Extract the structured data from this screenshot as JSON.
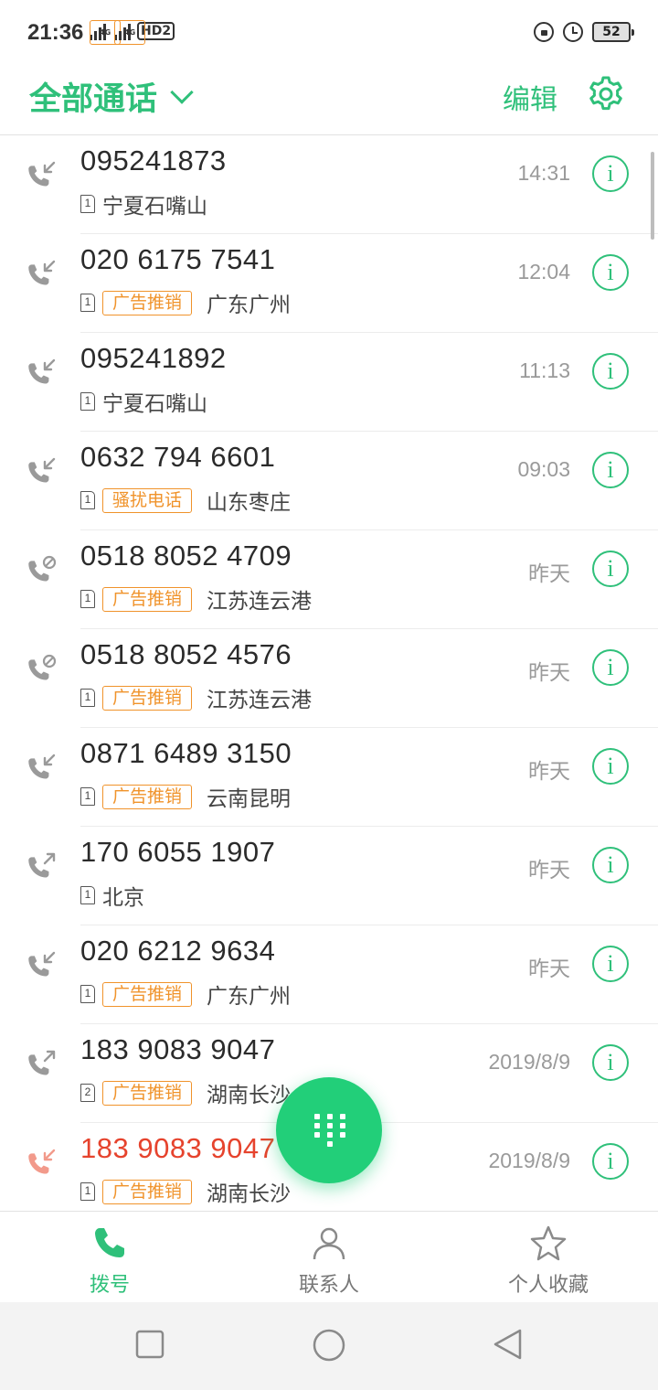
{
  "status_bar": {
    "time": "21:36",
    "net_tag": "4G",
    "hd_label": "HD2",
    "battery": "52"
  },
  "header": {
    "filter_label": "全部通话",
    "edit_label": "编辑"
  },
  "colors": {
    "accent": "#2fc07a",
    "missed": "#e6432d",
    "tag": "#f0932b"
  },
  "calls": [
    {
      "number": "095241873",
      "sim": "1",
      "tag": "",
      "location": "宁夏石嘴山",
      "time": "14:31",
      "type": "incoming"
    },
    {
      "number": "020 6175 7541",
      "sim": "1",
      "tag": "广告推销",
      "location": "广东广州",
      "time": "12:04",
      "type": "incoming"
    },
    {
      "number": "095241892",
      "sim": "1",
      "tag": "",
      "location": "宁夏石嘴山",
      "time": "11:13",
      "type": "incoming"
    },
    {
      "number": "0632 794 6601",
      "sim": "1",
      "tag": "骚扰电话",
      "location": "山东枣庄",
      "time": "09:03",
      "type": "incoming"
    },
    {
      "number": "0518 8052 4709",
      "sim": "1",
      "tag": "广告推销",
      "location": "江苏连云港",
      "time": "昨天",
      "type": "blocked"
    },
    {
      "number": "0518 8052 4576",
      "sim": "1",
      "tag": "广告推销",
      "location": "江苏连云港",
      "time": "昨天",
      "type": "blocked"
    },
    {
      "number": "0871 6489 3150",
      "sim": "1",
      "tag": "广告推销",
      "location": "云南昆明",
      "time": "昨天",
      "type": "incoming"
    },
    {
      "number": "170 6055 1907",
      "sim": "1",
      "tag": "",
      "location": "北京",
      "time": "昨天",
      "type": "outgoing"
    },
    {
      "number": "020 6212 9634",
      "sim": "1",
      "tag": "广告推销",
      "location": "广东广州",
      "time": "昨天",
      "type": "incoming"
    },
    {
      "number": "183 9083 9047",
      "sim": "2",
      "tag": "广告推销",
      "location": "湖南长沙",
      "time": "2019/8/9",
      "type": "outgoing"
    },
    {
      "number": "183 9083 9047",
      "sim": "1",
      "tag": "广告推销",
      "location": "湖南长沙",
      "time": "2019/8/9",
      "type": "missed"
    }
  ],
  "info_glyph": "i",
  "tabs": [
    {
      "label": "拨号",
      "icon": "phone-icon",
      "active": true
    },
    {
      "label": "联系人",
      "icon": "person-icon",
      "active": false
    },
    {
      "label": "个人收藏",
      "icon": "star-icon",
      "active": false
    }
  ],
  "nav": [
    "recents-nav-icon",
    "home-nav-icon",
    "back-nav-icon"
  ]
}
